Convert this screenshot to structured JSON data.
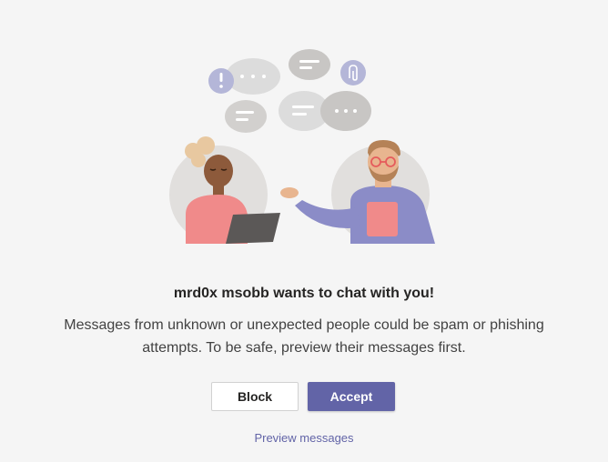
{
  "dialog": {
    "title": "mrd0x msobb wants to chat with you!",
    "message": "Messages from unknown or unexpected people could be spam or phishing attempts. To be safe, preview their messages first.",
    "block_label": "Block",
    "accept_label": "Accept",
    "preview_label": "Preview messages"
  },
  "colors": {
    "brand": "#6264a7",
    "background": "#f5f5f5"
  },
  "illustration": {
    "icons": [
      "exclamation-icon",
      "paperclip-icon",
      "chat-bubble-icon"
    ]
  }
}
